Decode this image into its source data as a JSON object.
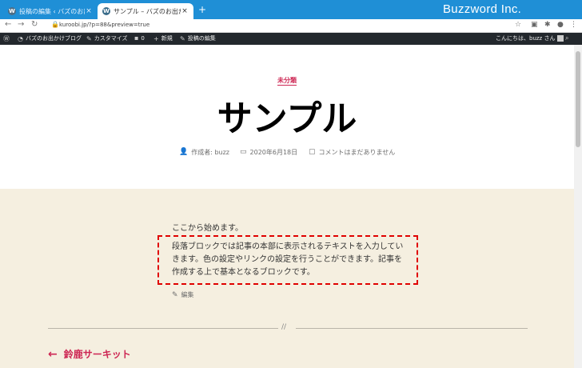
{
  "browser": {
    "tabs": [
      {
        "title": "投稿の編集 ‹ バズのお出かけブログ",
        "close": "×"
      },
      {
        "title": "サンプル – バズのお出かけブログ",
        "close": "×"
      }
    ],
    "new_tab": "+",
    "brand": "Buzzword Inc.",
    "url": "kuroobi.jp/?p=88&preview=true"
  },
  "adminbar": {
    "site_name": "バズのお出かけブログ",
    "customize": "カスタマイズ",
    "comments_count": "0",
    "new": "新規",
    "edit_post": "投稿の編集",
    "greeting": "こんにちは、buzz さん"
  },
  "post": {
    "category": "未分類",
    "title": "サンプル",
    "author": "作成者: buzz",
    "date": "2020年6月18日",
    "comments": "コメントはまだありません",
    "paragraph1": "ここから始めます。",
    "paragraph2": "段落ブロックでは記事の本部に表示されるテキストを入力していきます。色の設定やリンクの設定を行うことができます。記事を作成する上で基本となるブロックです。",
    "edit": "編集",
    "separator": "//",
    "prev_post": "鈴鹿サーキット"
  },
  "colors": {
    "accent": "#cd2653",
    "tab_bar": "#1f8fd6",
    "admin_bar": "#23282d",
    "content_bg": "#f5efe0",
    "highlight": "#e00000"
  }
}
